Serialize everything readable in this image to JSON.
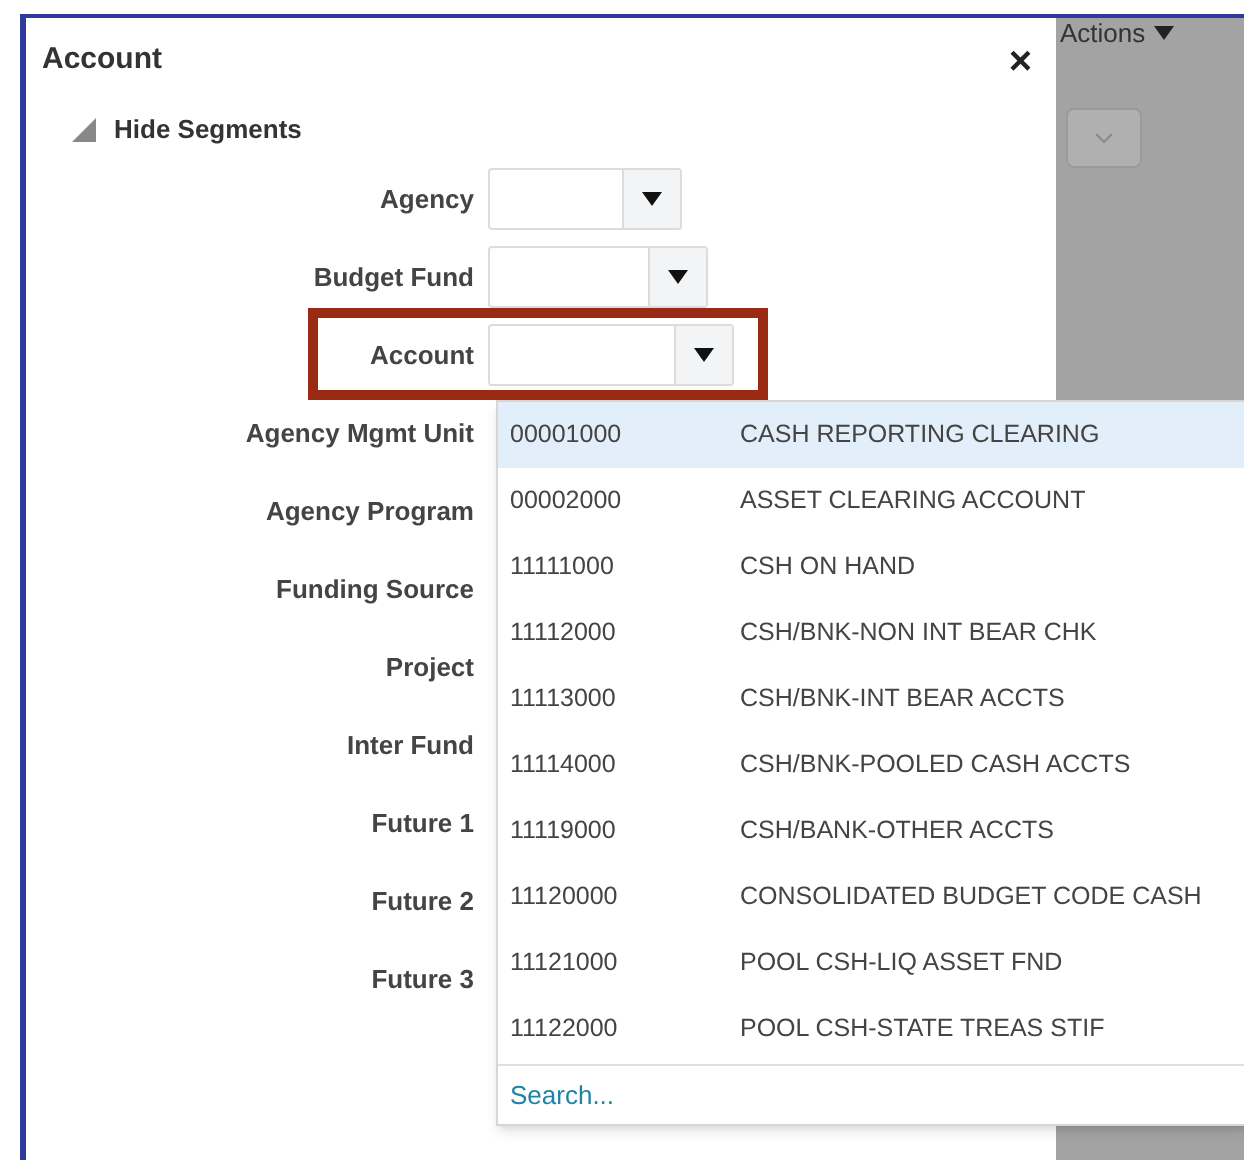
{
  "dialog": {
    "title": "Account",
    "close": "×"
  },
  "segments_toggle": {
    "label": "Hide Segments",
    "expanded": true
  },
  "segments": [
    {
      "label": "Agency",
      "kind": "select",
      "highlighted": false
    },
    {
      "label": "Budget Fund",
      "kind": "select",
      "highlighted": false
    },
    {
      "label": "Account",
      "kind": "select",
      "highlighted": true
    },
    {
      "label": "Agency Mgmt Unit",
      "kind": "covered",
      "highlighted": false
    },
    {
      "label": "Agency Program",
      "kind": "covered",
      "highlighted": false
    },
    {
      "label": "Funding Source",
      "kind": "covered",
      "highlighted": false
    },
    {
      "label": "Project",
      "kind": "covered",
      "highlighted": false
    },
    {
      "label": "Inter Fund",
      "kind": "covered",
      "highlighted": false
    },
    {
      "label": "Future 1",
      "kind": "covered",
      "highlighted": false
    },
    {
      "label": "Future 2",
      "kind": "covered",
      "highlighted": false
    },
    {
      "label": "Future 3",
      "kind": "covered",
      "highlighted": false
    }
  ],
  "account_list": {
    "options": [
      {
        "code": "00001000",
        "description": "CASH REPORTING CLEARING",
        "selected": true
      },
      {
        "code": "00002000",
        "description": "ASSET CLEARING ACCOUNT",
        "selected": false
      },
      {
        "code": "11111000",
        "description": "CSH ON HAND",
        "selected": false
      },
      {
        "code": "11112000",
        "description": "CSH/BNK-NON INT BEAR CHK",
        "selected": false
      },
      {
        "code": "11113000",
        "description": "CSH/BNK-INT BEAR ACCTS",
        "selected": false
      },
      {
        "code": "11114000",
        "description": "CSH/BNK-POOLED CASH ACCTS",
        "selected": false
      },
      {
        "code": "11119000",
        "description": "CSH/BANK-OTHER ACCTS",
        "selected": false
      },
      {
        "code": "11120000",
        "description": "CONSOLIDATED BUDGET CODE CASH",
        "selected": false
      },
      {
        "code": "11121000",
        "description": "POOL CSH-LIQ ASSET FND",
        "selected": false
      },
      {
        "code": "11122000",
        "description": "POOL CSH-STATE TREAS STIF",
        "selected": false
      }
    ],
    "search_link": "Search..."
  },
  "background": {
    "actions_menu": "Actions"
  }
}
